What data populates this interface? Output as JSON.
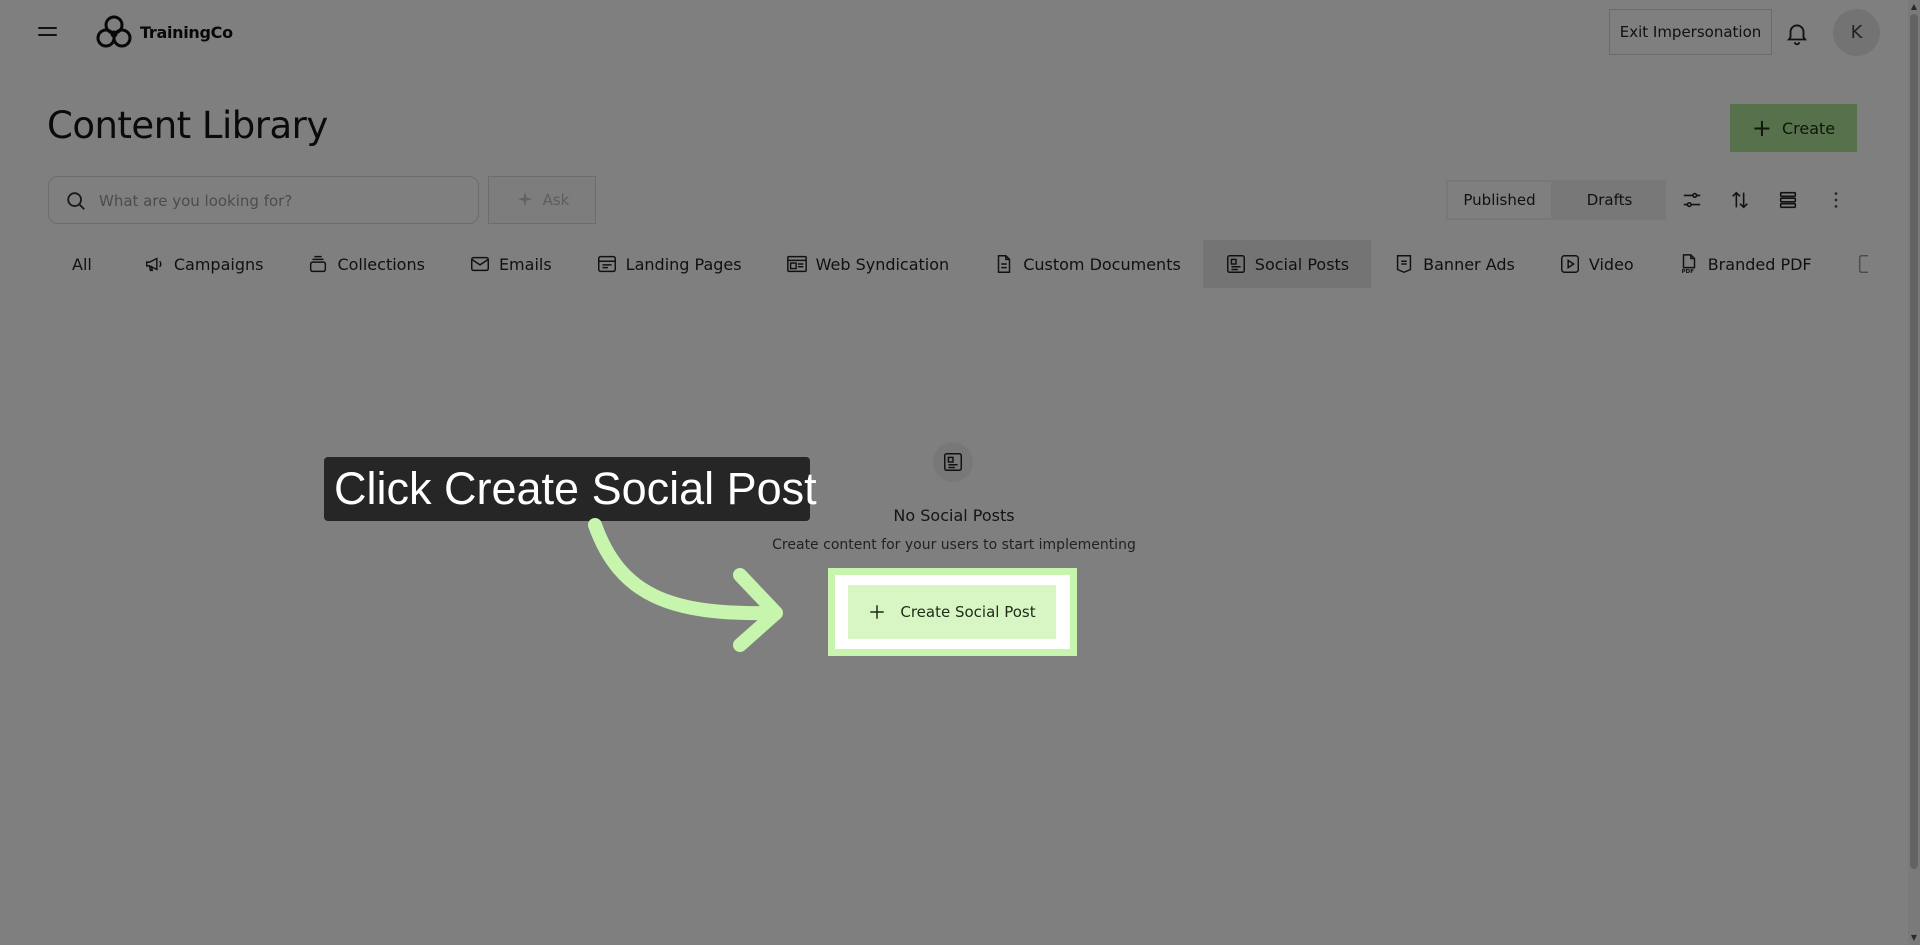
{
  "header": {
    "logo_text": "TrainingCo",
    "exit_label": "Exit Impersonation",
    "avatar_initial": "K",
    "icons": {
      "menu": "hamburger-icon",
      "bell": "bell-icon"
    }
  },
  "page": {
    "title": "Content Library",
    "create_label": "Create"
  },
  "search": {
    "placeholder": "What are you looking for?",
    "ask_label": "Ask"
  },
  "status_toggle": {
    "published_label": "Published",
    "drafts_label": "Drafts",
    "selected": "Published"
  },
  "toolbar_icons": [
    "filter-sliders-icon",
    "sort-icon",
    "list-view-icon",
    "more-vertical-icon"
  ],
  "tabs": [
    {
      "label": "All",
      "icon": ""
    },
    {
      "label": "Campaigns",
      "icon": "megaphone-icon"
    },
    {
      "label": "Collections",
      "icon": "stack-icon"
    },
    {
      "label": "Emails",
      "icon": "mail-icon"
    },
    {
      "label": "Landing Pages",
      "icon": "browser-icon"
    },
    {
      "label": "Web Syndication",
      "icon": "web-window-icon"
    },
    {
      "label": "Custom Documents",
      "icon": "document-icon"
    },
    {
      "label": "Social Posts",
      "icon": "social-post-icon",
      "active": true
    },
    {
      "label": "Banner Ads",
      "icon": "banner-icon"
    },
    {
      "label": "Video",
      "icon": "play-icon"
    },
    {
      "label": "Branded PDF",
      "icon": "pdf-icon"
    }
  ],
  "empty_state": {
    "icon": "social-post-icon",
    "title": "No Social Posts",
    "subtitle": "Create content for your users to start implementing",
    "cta_label": "Create Social Post"
  },
  "tutorial": {
    "callout_text": "Click Create Social Post",
    "highlight_color": "#c8f5ad"
  },
  "colors": {
    "accent_green": "#b0e39a",
    "dim_overlay": "rgba(0,0,0,0.5)",
    "callout_bg": "#262626"
  }
}
